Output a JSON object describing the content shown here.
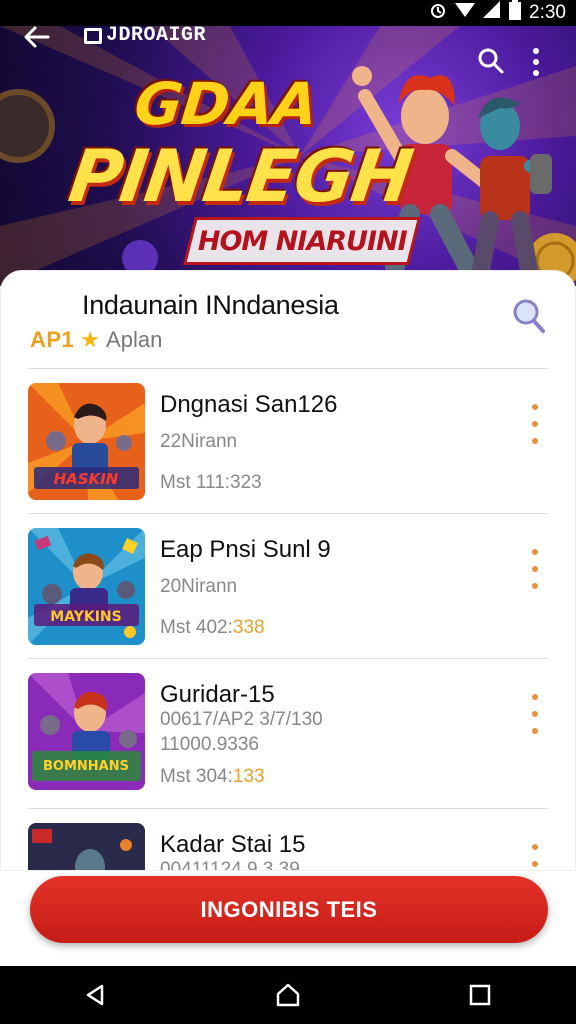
{
  "status_bar": {
    "time": "2:30",
    "icons": [
      "alarm-icon",
      "wifi-icon",
      "signal-icon",
      "battery-icon"
    ]
  },
  "app_bar": {
    "title": "JDROAIGR",
    "back_icon": "back-arrow-icon",
    "search_icon": "search-icon",
    "menu_icon": "more-vert-icon"
  },
  "hero": {
    "line1": "GDAA",
    "line2": "PINLEGH",
    "ribbon": "HOM NIARUINI"
  },
  "header": {
    "title": "Indaunain INndanesia",
    "code": "AP1",
    "category": "Aplan",
    "search_icon": "search-icon"
  },
  "games": [
    {
      "name": "Dngnasi San126",
      "meta1": "22Nirann",
      "meta2": "Mst 111:323",
      "meta2_highlight": "",
      "thumb_text": "HASKIN"
    },
    {
      "name": "Eap Pnsi Sunl 9",
      "meta1": "20Nirann",
      "meta2": "Mst 402:",
      "meta2_highlight": "338",
      "thumb_text": "MAYKINS"
    },
    {
      "name": "Guridar-15",
      "meta1": "00617/AP2 3/7/130",
      "meta2_extra": "11000.9336",
      "meta2": "Mst 304:",
      "meta2_highlight": "133",
      "thumb_text": "BOMNHANS"
    },
    {
      "name": "Kadar Stai 15",
      "meta1": "00411124 9 3.39",
      "meta2": "",
      "meta2_highlight": "",
      "thumb_text": ""
    }
  ],
  "cta": {
    "label": "INGONIBIS TEIS"
  },
  "colors": {
    "accent": "#e8913a",
    "cta": "#d42820",
    "code": "#f0a020",
    "star": "#f5b50a"
  }
}
